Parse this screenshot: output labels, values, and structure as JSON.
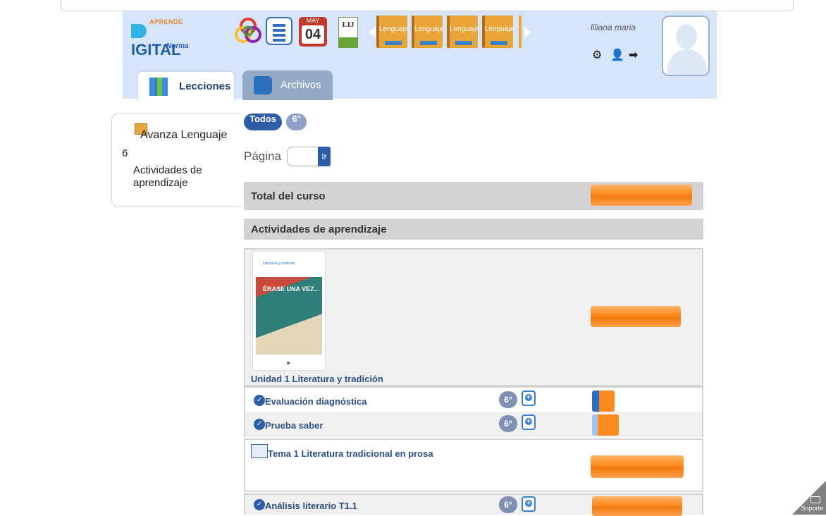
{
  "header": {
    "logo_top": "APRENDE",
    "logo_main": "IGITAL",
    "logo_brand": "Norma",
    "calendar_month": "MAY",
    "calendar_day": "04",
    "lij_label": "LIJ",
    "books": [
      "Lenguaje",
      "Lenguaje",
      "Lenguaje",
      "Lenguaje"
    ],
    "username": "liliana maria"
  },
  "tabs": {
    "lecciones": "Lecciones",
    "archivos": "Archivos"
  },
  "sidebar": {
    "course": "Avanza Lenguaje",
    "grade": "6",
    "section": "Actividades de aprendizaje"
  },
  "filters": {
    "todos": "Todos",
    "grade": "6°"
  },
  "pagination": {
    "label": "Página",
    "button": "Ir"
  },
  "sections": {
    "total": "Total del curso",
    "actividades": "Actividades de aprendizaje"
  },
  "unit": {
    "title": "Unidad 1 Literatura y tradición",
    "cover_heading": "Literatura y tradición",
    "cover_title": "ÉRASE UNA VEZ..."
  },
  "activities": [
    {
      "label": "Evaluación diagnóstica",
      "grade": "6°"
    },
    {
      "label": "Prueba saber",
      "grade": "6°"
    },
    {
      "label": "Análisis literario T1.1",
      "grade": "6°"
    }
  ],
  "tema": {
    "label": "Tema 1 Literatura tradicional en prosa"
  },
  "support": {
    "label": "Soporte"
  },
  "colors": {
    "header_bg": "#d6e5fa",
    "primary": "#2d5ca8",
    "progress": "#ff8a1e"
  }
}
